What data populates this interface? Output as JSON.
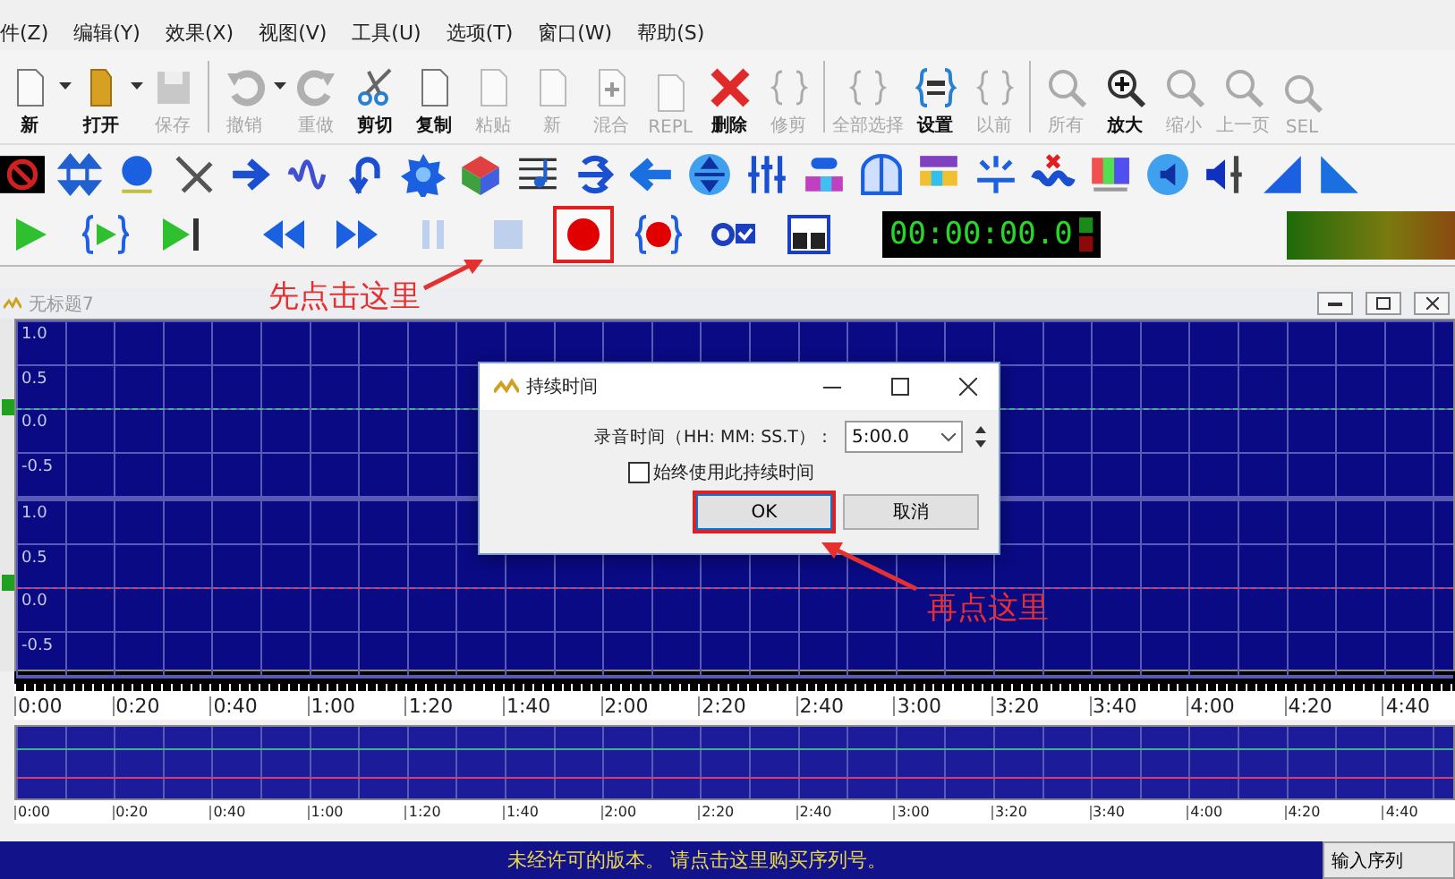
{
  "menu": [
    "件(Z)",
    "编辑(Y)",
    "效果(X)",
    "视图(V)",
    "工具(U)",
    "选项(T)",
    "窗口(W)",
    "帮助(S)"
  ],
  "toolbar_groups": [
    [
      {
        "kind": "new",
        "label": "新",
        "disabled": false,
        "has_menu": true
      },
      {
        "kind": "open",
        "label": "打开",
        "disabled": false,
        "has_menu": true
      },
      {
        "kind": "save",
        "label": "保存",
        "disabled": true,
        "has_menu": false
      }
    ],
    [
      {
        "kind": "undo",
        "label": "撤销",
        "disabled": true,
        "has_menu": true
      },
      {
        "kind": "redo",
        "label": "重做",
        "disabled": true,
        "has_menu": false
      },
      {
        "kind": "cut",
        "label": "剪切",
        "disabled": false,
        "has_menu": false
      },
      {
        "kind": "copy",
        "label": "复制",
        "disabled": false,
        "has_menu": false
      },
      {
        "kind": "paste",
        "label": "粘贴",
        "disabled": true,
        "has_menu": false
      },
      {
        "kind": "paste-new",
        "label": "新",
        "disabled": true,
        "has_menu": false
      },
      {
        "kind": "mix",
        "label": "混合",
        "disabled": true,
        "has_menu": false
      },
      {
        "kind": "replace",
        "label": "REPL",
        "disabled": true,
        "has_menu": false
      },
      {
        "kind": "delete",
        "label": "删除",
        "disabled": false,
        "has_menu": false
      },
      {
        "kind": "trim",
        "label": "修剪",
        "disabled": true,
        "has_menu": false
      }
    ],
    [
      {
        "kind": "select-all",
        "label": "全部选择",
        "disabled": true,
        "has_menu": false
      },
      {
        "kind": "settings",
        "label": "设置",
        "disabled": false,
        "has_menu": false
      },
      {
        "kind": "previous",
        "label": "以前",
        "disabled": true,
        "has_menu": false
      }
    ],
    [
      {
        "kind": "zoom-all",
        "label": "所有",
        "disabled": true,
        "has_menu": false
      },
      {
        "kind": "zoom-in",
        "label": "放大",
        "disabled": false,
        "has_menu": false
      },
      {
        "kind": "zoom-out",
        "label": "缩小",
        "disabled": true,
        "has_menu": false
      },
      {
        "kind": "zoom-prev",
        "label": "上一页",
        "disabled": true,
        "has_menu": false
      },
      {
        "kind": "zoom-sel",
        "label": "SEL",
        "disabled": true,
        "has_menu": false
      }
    ]
  ],
  "transport": [
    {
      "kind": "play",
      "disabled": false,
      "highlighted": false
    },
    {
      "kind": "play-selection",
      "disabled": false,
      "highlighted": false
    },
    {
      "kind": "play-to-end",
      "disabled": false,
      "highlighted": false
    },
    {
      "kind": "rewind",
      "disabled": false,
      "highlighted": false
    },
    {
      "kind": "fast-forward",
      "disabled": false,
      "highlighted": false
    },
    {
      "kind": "pause",
      "disabled": true,
      "highlighted": false
    },
    {
      "kind": "stop",
      "disabled": true,
      "highlighted": false
    },
    {
      "kind": "record",
      "disabled": false,
      "highlighted": true
    },
    {
      "kind": "record-selection",
      "disabled": false,
      "highlighted": false
    },
    {
      "kind": "record-options",
      "disabled": false,
      "highlighted": false
    },
    {
      "kind": "control-window",
      "disabled": false,
      "highlighted": false
    }
  ],
  "time_display": "00:00:00.0",
  "document": {
    "title": "无标题7"
  },
  "waveform": {
    "channels": [
      {
        "labels": [
          "1.0",
          "0.5",
          "0.0",
          "-0.5"
        ],
        "color": "#3fb38a"
      },
      {
        "labels": [
          "1.0",
          "0.5",
          "0.0",
          "-0.5"
        ],
        "color": "#d0406a"
      }
    ],
    "ruler": [
      "0:00",
      "0:20",
      "0:40",
      "1:00",
      "1:20",
      "1:40",
      "2:00",
      "2:20",
      "2:40",
      "3:00",
      "3:20",
      "3:40",
      "4:00",
      "4:20",
      "4:40"
    ]
  },
  "overview": {
    "ruler": [
      "0:00",
      "0:20",
      "0:40",
      "1:00",
      "1:20",
      "1:40",
      "2:00",
      "2:20",
      "2:40",
      "3:00",
      "3:20",
      "3:40",
      "4:00",
      "4:20",
      "4:40"
    ]
  },
  "dialog": {
    "title": "持续时间",
    "label": "录音时间（HH: MM: SS.T）：",
    "value": "5:00.0",
    "checkbox": {
      "label": "始终使用此持续时间",
      "checked": false
    },
    "buttons": [
      {
        "label": "OK",
        "default": true,
        "highlighted": true
      },
      {
        "label": "取消",
        "default": false,
        "highlighted": false
      }
    ]
  },
  "annotations": [
    "先点击这里",
    "再点这里"
  ],
  "status_bar": {
    "message": "未经许可的版本。 请点击这里购买序列号。",
    "button": "输入序列"
  }
}
